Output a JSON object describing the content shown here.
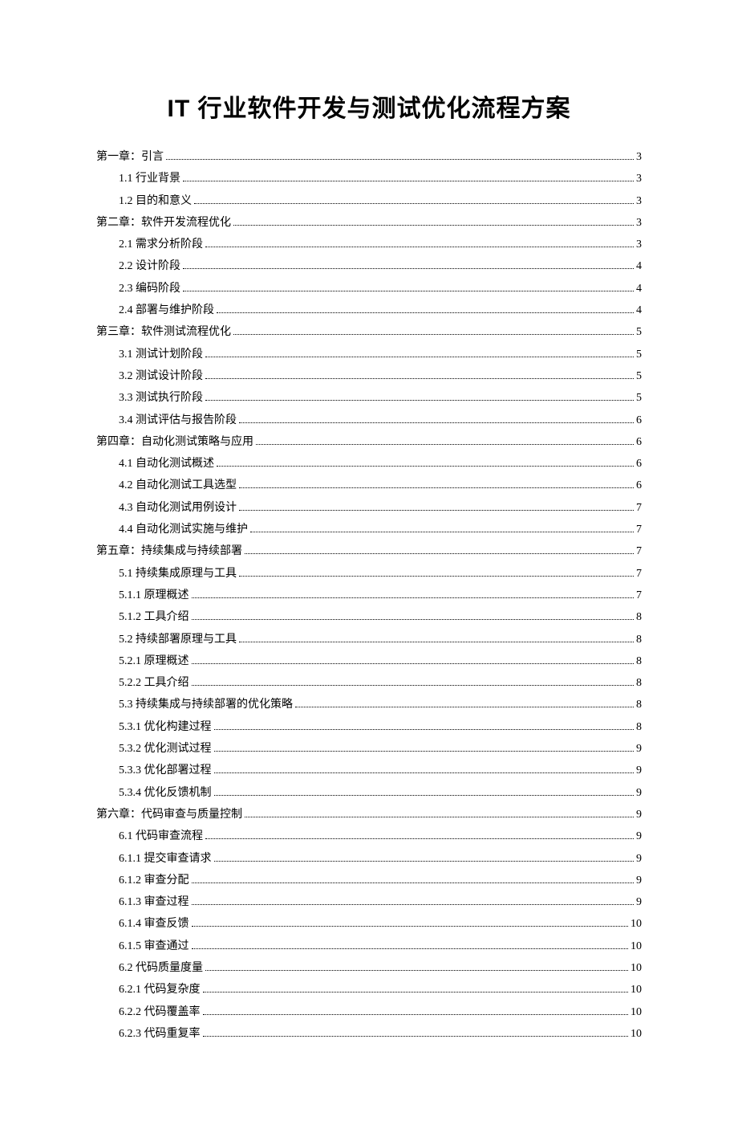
{
  "title": "IT 行业软件开发与测试优化流程方案",
  "toc": [
    {
      "label": "第一章：引言 ",
      "page": "3",
      "indent": 0
    },
    {
      "label": "1.1 行业背景 ",
      "page": "3",
      "indent": 1
    },
    {
      "label": "1.2 目的和意义",
      "page": "3",
      "indent": 1
    },
    {
      "label": "第二章：软件开发流程优化",
      "page": "3",
      "indent": 0
    },
    {
      "label": "2.1 需求分析阶段",
      "page": "3",
      "indent": 1
    },
    {
      "label": "2.2 设计阶段 ",
      "page": "4",
      "indent": 1
    },
    {
      "label": "2.3 编码阶段 ",
      "page": "4",
      "indent": 1
    },
    {
      "label": "2.4 部署与维护阶段",
      "page": "4",
      "indent": 1
    },
    {
      "label": "第三章：软件测试流程优化",
      "page": "5",
      "indent": 0
    },
    {
      "label": "3.1 测试计划阶段",
      "page": "5",
      "indent": 1
    },
    {
      "label": "3.2 测试设计阶段",
      "page": "5",
      "indent": 1
    },
    {
      "label": "3.3 测试执行阶段",
      "page": "5",
      "indent": 1
    },
    {
      "label": "3.4 测试评估与报告阶段",
      "page": "6",
      "indent": 1
    },
    {
      "label": "第四章：自动化测试策略与应用",
      "page": "6",
      "indent": 0
    },
    {
      "label": "4.1 自动化测试概述",
      "page": "6",
      "indent": 1
    },
    {
      "label": "4.2 自动化测试工具选型",
      "page": "6",
      "indent": 1
    },
    {
      "label": "4.3 自动化测试用例设计",
      "page": "7",
      "indent": 1
    },
    {
      "label": "4.4 自动化测试实施与维护",
      "page": "7",
      "indent": 1
    },
    {
      "label": "第五章：持续集成与持续部署",
      "page": "7",
      "indent": 0
    },
    {
      "label": "5.1 持续集成原理与工具",
      "page": "7",
      "indent": 1
    },
    {
      "label": "5.1.1 原理概述",
      "page": "7",
      "indent": 1
    },
    {
      "label": "5.1.2 工具介绍",
      "page": "8",
      "indent": 1
    },
    {
      "label": "5.2 持续部署原理与工具",
      "page": "8",
      "indent": 1
    },
    {
      "label": "5.2.1 原理概述",
      "page": "8",
      "indent": 1
    },
    {
      "label": "5.2.2 工具介绍",
      "page": "8",
      "indent": 1
    },
    {
      "label": "5.3 持续集成与持续部署的优化策略 ",
      "page": "8",
      "indent": 1
    },
    {
      "label": "5.3.1 优化构建过程",
      "page": "8",
      "indent": 1
    },
    {
      "label": "5.3.2 优化测试过程",
      "page": "9",
      "indent": 1
    },
    {
      "label": "5.3.3 优化部署过程",
      "page": "9",
      "indent": 1
    },
    {
      "label": "5.3.4 优化反馈机制",
      "page": "9",
      "indent": 1
    },
    {
      "label": "第六章：代码审查与质量控制",
      "page": "9",
      "indent": 0
    },
    {
      "label": "6.1 代码审查流程",
      "page": "9",
      "indent": 1
    },
    {
      "label": "6.1.1 提交审查请求",
      "page": "9",
      "indent": 1
    },
    {
      "label": "6.1.2 审查分配",
      "page": "9",
      "indent": 1
    },
    {
      "label": "6.1.3 审查过程",
      "page": "9",
      "indent": 1
    },
    {
      "label": "6.1.4 审查反馈",
      "page": "10",
      "indent": 1
    },
    {
      "label": "6.1.5 审查通过 ",
      "page": "10",
      "indent": 1
    },
    {
      "label": "6.2 代码质量度量",
      "page": "10",
      "indent": 1
    },
    {
      "label": "6.2.1 代码复杂度",
      "page": "10",
      "indent": 1
    },
    {
      "label": "6.2.2 代码覆盖率",
      "page": "10",
      "indent": 1
    },
    {
      "label": "6.2.3 代码重复率",
      "page": "10",
      "indent": 1
    }
  ]
}
